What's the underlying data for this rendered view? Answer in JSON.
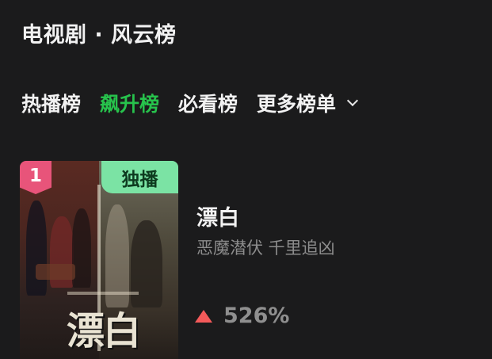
{
  "header": {
    "title": "电视剧 · 风云榜"
  },
  "tabs": [
    {
      "label": "热播榜",
      "active": false
    },
    {
      "label": "飙升榜",
      "active": true
    },
    {
      "label": "必看榜",
      "active": false
    },
    {
      "label": "更多榜单",
      "active": false
    }
  ],
  "colors": {
    "background": "#1b1b1c",
    "active_tab": "#27c24c",
    "rank_badge": "#e8547a",
    "exclusive_badge": "#7be3a4",
    "up_arrow": "#f45a5a"
  },
  "items": [
    {
      "rank": "1",
      "badge": "独播",
      "poster_title": "漂白",
      "title": "漂白",
      "tags": "恶魔潜伏 千里追凶",
      "trend_icon": "up-arrow-icon",
      "change": "526%"
    }
  ]
}
